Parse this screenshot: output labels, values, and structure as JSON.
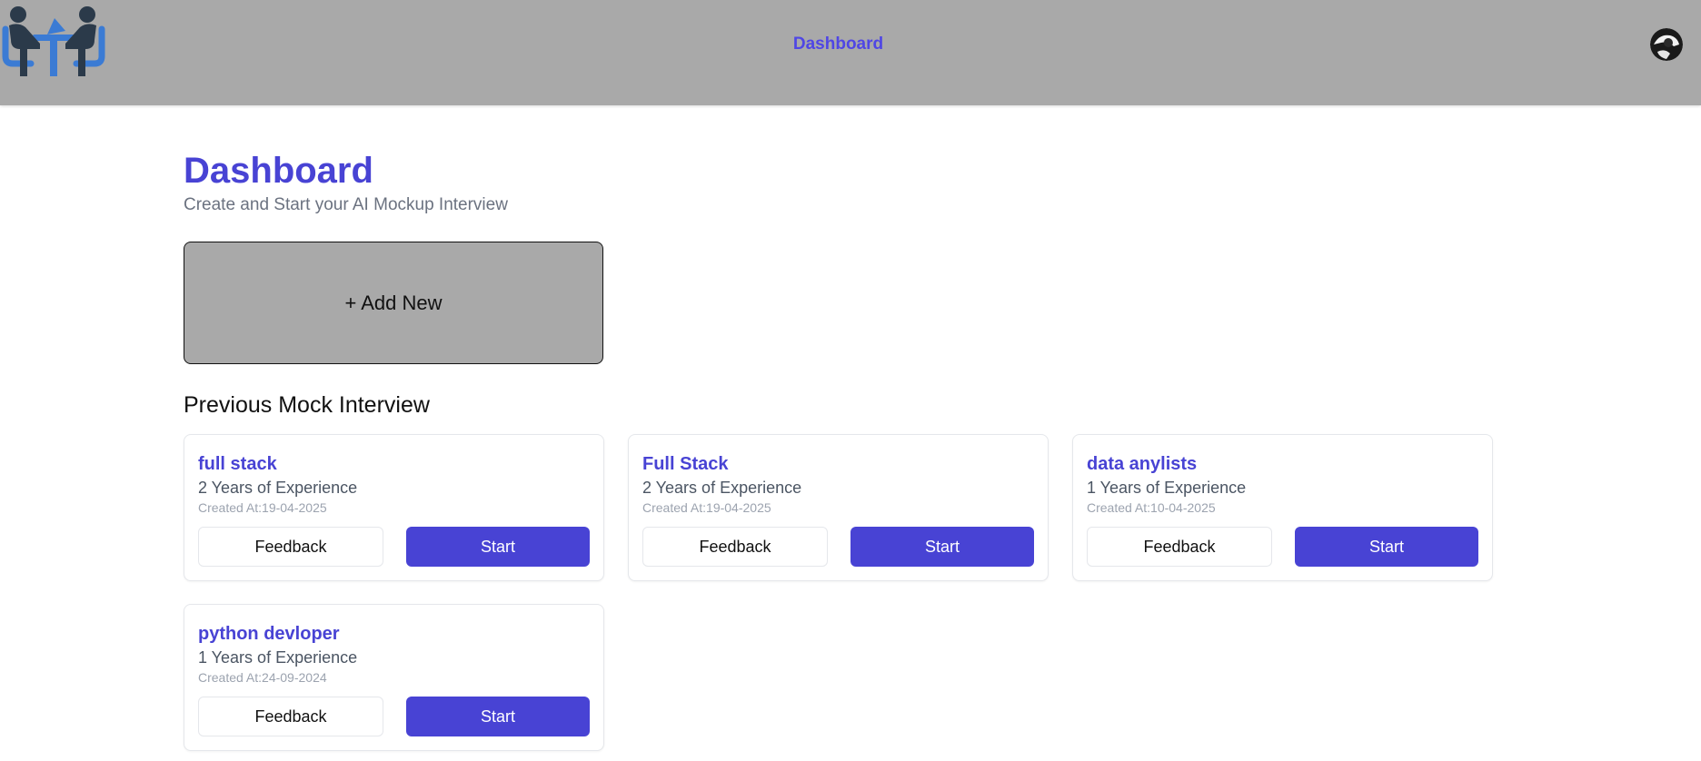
{
  "header": {
    "nav_dashboard": "Dashboard"
  },
  "page": {
    "title": "Dashboard",
    "subtitle": "Create and Start your AI Mockup Interview",
    "add_new_label": "+ Add New",
    "section_title": "Previous Mock Interview"
  },
  "interviews": [
    {
      "title": "full stack",
      "experience": "2 Years of Experience",
      "created": "Created At:19-04-2025",
      "feedback_label": "Feedback",
      "start_label": "Start"
    },
    {
      "title": "Full Stack",
      "experience": "2 Years of Experience",
      "created": "Created At:19-04-2025",
      "feedback_label": "Feedback",
      "start_label": "Start"
    },
    {
      "title": "data anylists",
      "experience": "1 Years of Experience",
      "created": "Created At:10-04-2025",
      "feedback_label": "Feedback",
      "start_label": "Start"
    },
    {
      "title": "python devloper",
      "experience": "1 Years of Experience",
      "created": "Created At:24-09-2024",
      "feedback_label": "Feedback",
      "start_label": "Start"
    }
  ],
  "colors": {
    "accent": "#4843d4",
    "header_bg": "#a9a9a9",
    "nav_link": "#4f46e5"
  },
  "icons": {
    "logo": "interview-logo-icon",
    "avatar": "user-avatar-icon"
  }
}
